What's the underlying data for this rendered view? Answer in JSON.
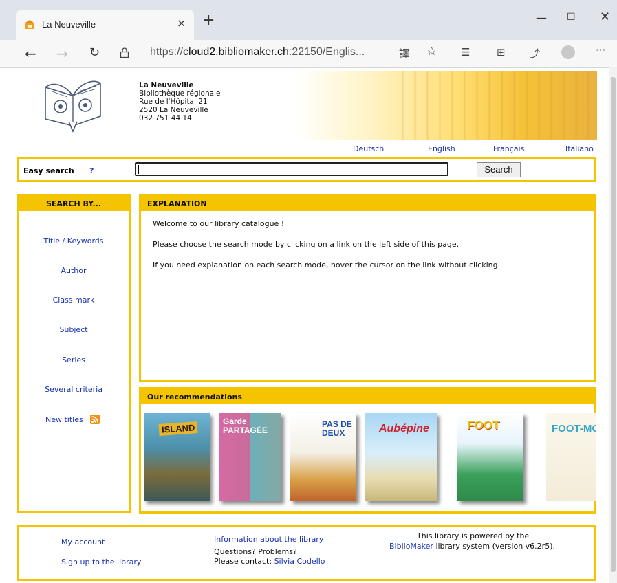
{
  "browser": {
    "tab_title": "La Neuveville",
    "url_prefix": "https://",
    "url_host": "cloud2.bibliomaker.ch",
    "url_rest": ":22150/Englis..."
  },
  "library": {
    "name": "La Neuveville",
    "subtitle": "Bibliothèque régionale",
    "street": "Rue de l'Hôpital 21",
    "city": "2520 La Neuveville",
    "phone": "032 751 44 14"
  },
  "languages": [
    "Deutsch",
    "English",
    "Français",
    "Italiano"
  ],
  "easy_search": {
    "label": "Easy search",
    "help": "?",
    "value": "",
    "button": "Search"
  },
  "sidebar": {
    "title": "SEARCH BY...",
    "items": [
      "Title / Keywords",
      "Author",
      "Class mark",
      "Subject",
      "Series",
      "Several criteria",
      "New titles"
    ]
  },
  "explanation": {
    "title": "EXPLANATION",
    "lines": [
      "Welcome to our library catalogue !",
      "Please choose the search mode by clicking on a link on the left side of this page.",
      "If you need explanation on each search mode, hover the cursor on the link without clicking."
    ]
  },
  "recommendations": {
    "title": "Our recommendations",
    "covers": [
      "ISLAND",
      "Garde PARTAGÉE",
      "PAS DE DEUX",
      "Aubépine",
      "FOOT",
      "FOOT-MO"
    ]
  },
  "footer": {
    "my_account": "My account",
    "signup": "Sign up to the library",
    "info": "Information about the library",
    "questions": "Questions? Problems?",
    "contact_prefix": "Please contact:",
    "contact_name": "Silvia Codello",
    "powered_1": "This library is powered by the",
    "powered_link": "BiblioMaker",
    "powered_2": "library system (version v6.2r5)."
  }
}
